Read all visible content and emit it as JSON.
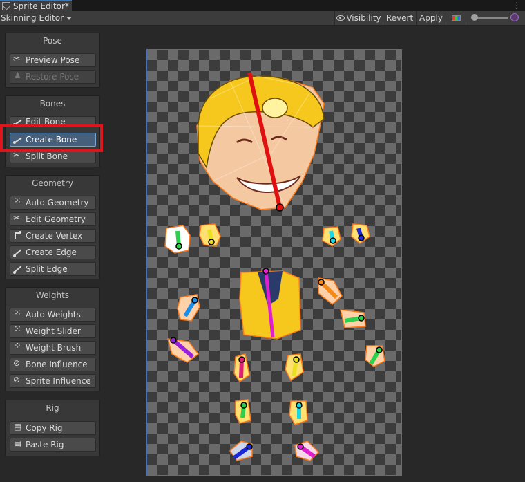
{
  "window": {
    "tab_title": "Sprite Editor*"
  },
  "toolbar": {
    "mode": "Skinning Editor",
    "visibility": "Visibility",
    "revert": "Revert",
    "apply": "Apply"
  },
  "panels": {
    "pose": {
      "title": "Pose",
      "buttons": [
        "Preview Pose",
        "Restore Pose"
      ]
    },
    "bones": {
      "title": "Bones",
      "buttons": [
        "Edit Bone",
        "Create Bone",
        "Split Bone"
      ],
      "selected": "Create Bone"
    },
    "geometry": {
      "title": "Geometry",
      "buttons": [
        "Auto Geometry",
        "Edit Geometry",
        "Create Vertex",
        "Create Edge",
        "Split Edge"
      ]
    },
    "weights": {
      "title": "Weights",
      "buttons": [
        "Auto Weights",
        "Weight Slider",
        "Weight Brush",
        "Bone Influence",
        "Sprite Influence"
      ]
    },
    "rig": {
      "title": "Rig",
      "buttons": [
        "Copy Rig",
        "Paste Rig"
      ]
    }
  },
  "icons": {
    "preview_pose": "scissors-icon",
    "restore_pose": "person-icon",
    "create_bone": "bone-icon",
    "copy_rig": "clipboard-icon"
  },
  "colors": {
    "selection_highlight": "#e0141b",
    "selected_button": "#46607c",
    "canvas_border": "#4c6fb0"
  }
}
